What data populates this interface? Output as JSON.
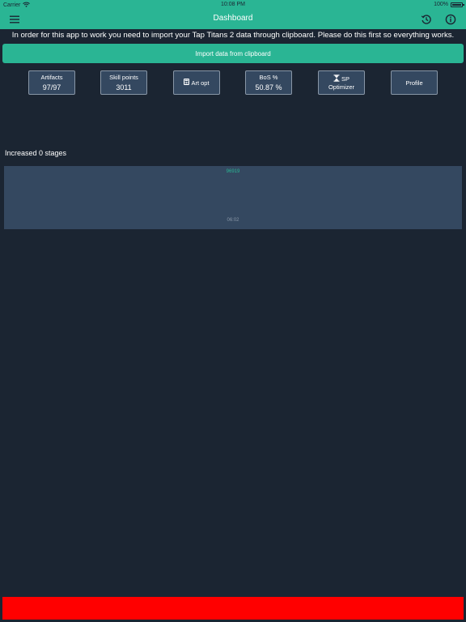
{
  "status_bar": {
    "carrier": "Carrier",
    "time": "10:08 PM",
    "battery": "100%",
    "wifi_icon": "wifi-icon",
    "battery_icon": "battery-icon"
  },
  "nav": {
    "title": "Dashboard",
    "menu_icon": "hamburger-menu-icon",
    "history_icon": "history-icon",
    "info_icon": "info-icon"
  },
  "instructions": "In order for this app to work you need to import your Tap Titans 2 data through clipboard. Please do this first so everything works.",
  "import_button": "Import data from clipboard",
  "stats": {
    "artifacts": {
      "label": "Artifacts",
      "value": "97/97"
    },
    "skill_points": {
      "label": "Skill points",
      "value": "3011"
    },
    "art_opt": {
      "label": "Art opt",
      "icon": "calculator-icon"
    },
    "bos": {
      "label": "BoS %",
      "value": "50.87 %"
    },
    "sp_optimizer": {
      "label_line1": "SP",
      "label_line2": "Optimizer",
      "icon": "hourglass-icon"
    },
    "profile": {
      "label": "Profile"
    }
  },
  "stages_increase": "Increased 0 stages",
  "graph": {
    "value": "96919",
    "time": "06:02"
  },
  "colors": {
    "accent": "#2ab594",
    "background": "#1b2532",
    "tile": "#344860",
    "banner": "#ff0000"
  }
}
